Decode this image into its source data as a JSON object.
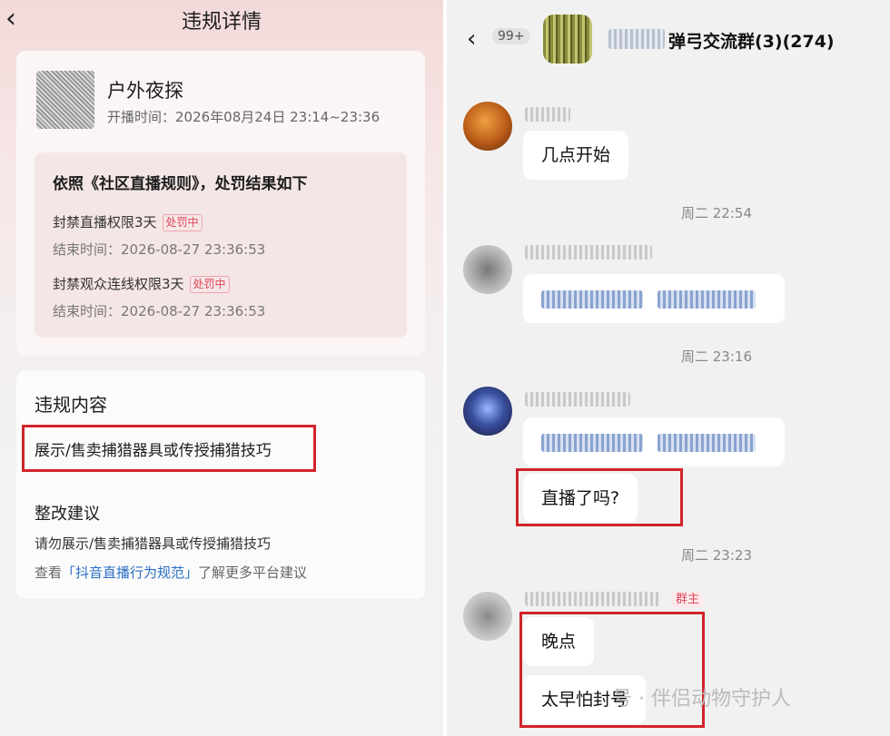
{
  "left": {
    "header": {
      "back_icon": "chevron-left-icon",
      "title": "违规详情"
    },
    "stream": {
      "title": "户外夜探",
      "time": "开播时间：2026年08月24日 23:14~23:36"
    },
    "penalty": {
      "rule": "依照《社区直播规则》，处罚结果如下",
      "items": [
        {
          "label": "封禁直播权限3天",
          "status": "处罚中",
          "end": "结束时间：2026-08-27 23:36:53"
        },
        {
          "label": "封禁观众连线权限3天",
          "status": "处罚中",
          "end": "结束时间：2026-08-27 23:36:53"
        }
      ]
    },
    "violation": {
      "heading": "违规内容",
      "text": "展示/售卖捕猎器具或传授捕猎技巧"
    },
    "suggestion": {
      "heading": "整改建议",
      "text": "请勿展示/售卖捕猎器具或传授捕猎技巧",
      "link_prefix": "查看",
      "link_text": "「抖音直播行为规范」",
      "link_suffix": "了解更多平台建议"
    }
  },
  "right": {
    "header": {
      "back_icon": "chevron-left-icon",
      "unread": "99+",
      "group_title": "弹弓交流群(3)(274)"
    },
    "messages": [
      {
        "text": "几点开始"
      },
      {
        "timestamp": "周二 22:54"
      },
      {
        "timestamp": "周二 23:16"
      },
      {
        "text": "直播了吗?"
      },
      {
        "timestamp": "周二 23:23"
      },
      {
        "role_badge": "群主"
      },
      {
        "text": "晚点"
      },
      {
        "text": "太早怕封号"
      }
    ],
    "watermark": "号 · 伴侣动物守护人"
  },
  "colors": {
    "highlight": "#d2232a",
    "badge": "#e0465a",
    "link": "#2b6fc7"
  }
}
